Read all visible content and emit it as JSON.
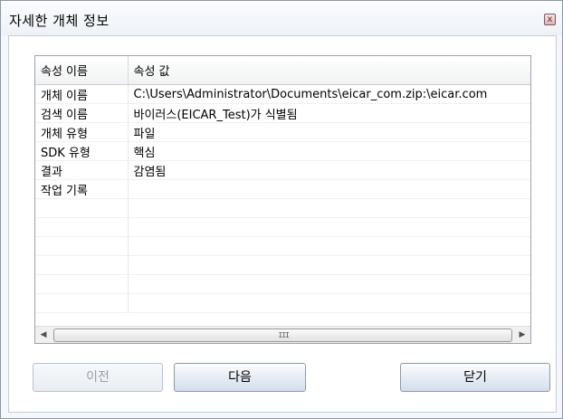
{
  "window": {
    "title": "자세한 개체 정보",
    "close_glyph": "x"
  },
  "grid": {
    "columns": [
      "속성 이름",
      "속성 값"
    ],
    "rows": [
      [
        "개체 이름",
        "C:\\Users\\Administrator\\Documents\\eicar_com.zip:\\eicar.com"
      ],
      [
        "검색 이름",
        "바이러스(EICAR_Test)가 식별됨"
      ],
      [
        "개체 유형",
        "파일"
      ],
      [
        "SDK 유형",
        "핵심"
      ],
      [
        "결과",
        "감염됨"
      ],
      [
        "작업 기록",
        ""
      ],
      [
        "",
        ""
      ],
      [
        "",
        ""
      ],
      [
        "",
        ""
      ],
      [
        "",
        ""
      ],
      [
        "",
        ""
      ],
      [
        "",
        ""
      ]
    ]
  },
  "scrollbar": {
    "left_arrow": "◀",
    "right_arrow": "▶",
    "grip": "III"
  },
  "buttons": {
    "prev": "이전",
    "next": "다음",
    "close": "닫기"
  }
}
